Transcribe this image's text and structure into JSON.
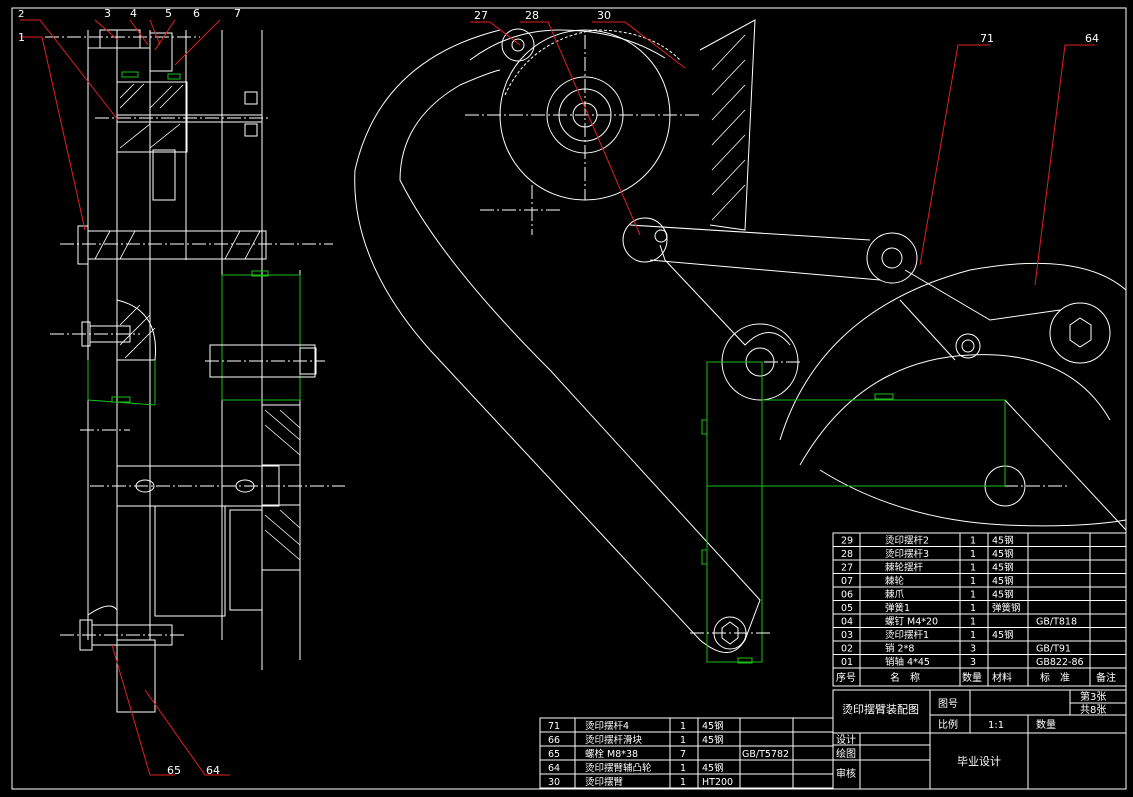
{
  "balloons": {
    "b2": "2",
    "b3": "3",
    "b4": "4",
    "b5": "5",
    "b6": "6",
    "b7": "7",
    "b1": "1",
    "b27": "27",
    "b28": "28",
    "b30": "30",
    "b71": "71",
    "b64top": "64",
    "b65": "65",
    "b64bot": "64"
  },
  "bom_upper": {
    "rows": [
      {
        "no": "29",
        "name": "烫印摆杆2",
        "qty": "1",
        "mat": "45钢",
        "std": "",
        "note": ""
      },
      {
        "no": "28",
        "name": "烫印摆杆3",
        "qty": "1",
        "mat": "45钢",
        "std": "",
        "note": ""
      },
      {
        "no": "27",
        "name": "棘轮摆杆",
        "qty": "1",
        "mat": "45钢",
        "std": "",
        "note": ""
      },
      {
        "no": "07",
        "name": "棘轮",
        "qty": "1",
        "mat": "45钢",
        "std": "",
        "note": ""
      },
      {
        "no": "06",
        "name": "棘爪",
        "qty": "1",
        "mat": "45钢",
        "std": "",
        "note": ""
      },
      {
        "no": "05",
        "name": "弹簧1",
        "qty": "1",
        "mat": "弹簧钢",
        "std": "",
        "note": ""
      },
      {
        "no": "04",
        "name": "螺钉 M4*20",
        "qty": "1",
        "mat": "",
        "std": "GB/T818",
        "note": ""
      },
      {
        "no": "03",
        "name": "烫印摆杆1",
        "qty": "1",
        "mat": "45钢",
        "std": "",
        "note": ""
      },
      {
        "no": "02",
        "name": "销 2*8",
        "qty": "3",
        "mat": "",
        "std": "GB/T91",
        "note": ""
      },
      {
        "no": "01",
        "name": "销轴 4*45",
        "qty": "3",
        "mat": "",
        "std": "GB822-86",
        "note": ""
      }
    ],
    "header": {
      "no": "序号",
      "name": "名　称",
      "qty": "数量",
      "mat": "材料",
      "std": "标　准",
      "note": "备注"
    }
  },
  "bom_lower": {
    "rows": [
      {
        "no": "71",
        "name": "烫印摆杆4",
        "qty": "1",
        "mat": "45钢",
        "std": ""
      },
      {
        "no": "66",
        "name": "烫印摆杆滑块",
        "qty": "1",
        "mat": "45钢",
        "std": ""
      },
      {
        "no": "65",
        "name": "螺栓 M8*38",
        "qty": "7",
        "mat": "",
        "std": "GB/T5782"
      },
      {
        "no": "64",
        "name": "烫印摆臂辅凸轮",
        "qty": "1",
        "mat": "45钢",
        "std": ""
      },
      {
        "no": "30",
        "name": "烫印摆臂",
        "qty": "1",
        "mat": "HT200",
        "std": ""
      }
    ]
  },
  "title_block": {
    "drawing_title": "烫印摆臂装配图",
    "drawing_no_label": "图号",
    "sheet": "第3张",
    "total": "共8张",
    "scale_label": "比例",
    "scale_value": "1:1",
    "qty_label": "数量",
    "design_label": "设计",
    "draw_label": "绘图",
    "review_label": "审核",
    "project": "毕业设计"
  }
}
